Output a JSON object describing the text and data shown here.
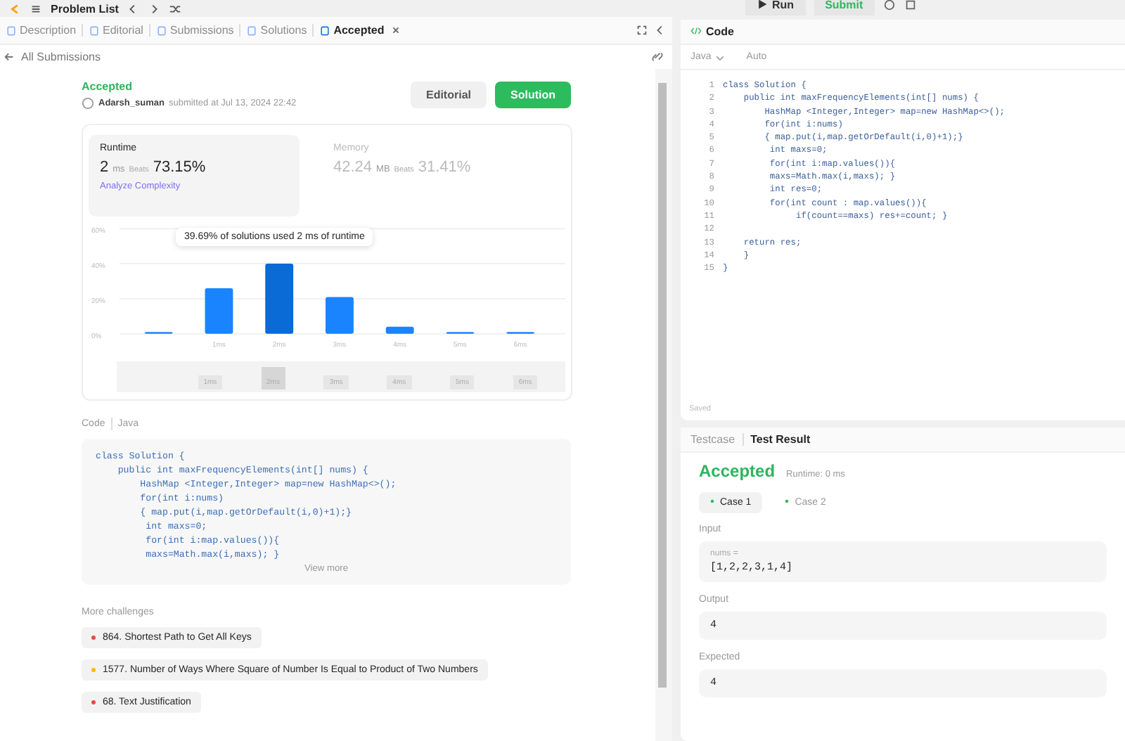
{
  "top_bar": {
    "title": "Problem List",
    "run": "Run",
    "submit": "Submit"
  },
  "left_tabs": [
    {
      "label": "Description",
      "selected": false
    },
    {
      "label": "Editorial",
      "selected": false
    },
    {
      "label": "Submissions",
      "selected": false
    },
    {
      "label": "Solutions",
      "selected": false
    },
    {
      "label": "Accepted",
      "selected": true,
      "closable": true
    }
  ],
  "back_link": "All Submissions",
  "submission": {
    "status": "Accepted",
    "user": "Adarsh_suman",
    "submitted": "submitted at Jul 13, 2024 22:42",
    "editorial_button": "Editorial",
    "solution_button": "Solution"
  },
  "runtime": {
    "title": "Runtime",
    "value": "2",
    "unit": "ms",
    "beats_label": "Beats",
    "beats": "73.15%",
    "analyze": "Analyze Complexity",
    "selected": true
  },
  "memory": {
    "title": "Memory",
    "value": "42.24",
    "unit": "MB",
    "beats_label": "Beats",
    "beats": "31.41%",
    "selected": false
  },
  "chart": {
    "tooltip": "39.69% of solutions used 2 ms of runtime",
    "bars": [
      {
        "selected": false
      },
      {
        "selected": false
      },
      {
        "selected": true
      },
      {
        "selected": false
      },
      {
        "selected": false
      },
      {
        "selected": false
      },
      {
        "selected": false
      }
    ],
    "chart_data": {
      "type": "bar",
      "categories": [
        null,
        "1ms",
        "2ms",
        "3ms",
        "4ms",
        "5ms",
        "6ms"
      ],
      "values": [
        1,
        26,
        40,
        21,
        4,
        1,
        1
      ],
      "ylim": [
        0,
        60
      ],
      "yticks": [
        {
          "value": 0,
          "label": "0%"
        },
        {
          "value": 20,
          "label": "20%"
        },
        {
          "value": 40,
          "label": "40%"
        },
        {
          "value": 60,
          "label": "60%"
        }
      ]
    },
    "range_labels": [
      {
        "label": "1ms",
        "selected": false
      },
      {
        "label": "2ms",
        "selected": true
      },
      {
        "label": "3ms",
        "selected": false
      },
      {
        "label": "4ms",
        "selected": false
      },
      {
        "label": "5ms",
        "selected": false
      },
      {
        "label": "6ms",
        "selected": false
      }
    ]
  },
  "code_section": {
    "label": "Code",
    "language": "Java",
    "view_more": "View more",
    "lines": [
      "class Solution {",
      "    public int maxFrequencyElements(int[] nums) {",
      "        HashMap <Integer,Integer> map=new HashMap<>();",
      "        for(int i:nums)",
      "        { map.put(i,map.getOrDefault(i,0)+1);}",
      "         int maxs=0;",
      "         for(int i:map.values()){",
      "         maxs=Math.max(i,maxs); }"
    ]
  },
  "more_challenges": {
    "title": "More challenges",
    "items": [
      {
        "label": "864. Shortest Path to Get All Keys",
        "color": "#ef4743"
      },
      {
        "label": "1577. Number of Ways Where Square of Number Is Equal to Product of Two Numbers",
        "color": "#ffb800"
      },
      {
        "label": "68. Text Justification",
        "color": "#ef4743"
      }
    ]
  },
  "editor": {
    "title": "Code",
    "language": "Java",
    "mode": "Auto",
    "saved": "Saved",
    "lines": [
      {
        "no": "1",
        "text": "class Solution {"
      },
      {
        "no": "2",
        "text": "    public int maxFrequencyElements(int[] nums) {"
      },
      {
        "no": "3",
        "text": "        HashMap <Integer,Integer> map=new HashMap<>();"
      },
      {
        "no": "4",
        "text": "        for(int i:nums)"
      },
      {
        "no": "5",
        "text": "        { map.put(i,map.getOrDefault(i,0)+1);}"
      },
      {
        "no": "6",
        "text": "         int maxs=0;"
      },
      {
        "no": "7",
        "text": "         for(int i:map.values()){"
      },
      {
        "no": "8",
        "text": "         maxs=Math.max(i,maxs); }"
      },
      {
        "no": "9",
        "text": "         int res=0;"
      },
      {
        "no": "10",
        "text": "         for(int count : map.values()){"
      },
      {
        "no": "11",
        "text": "              if(count==maxs) res+=count; }"
      },
      {
        "no": "12"
      },
      {
        "no": "13",
        "text": "    return res;"
      },
      {
        "no": "14",
        "text": "    }"
      },
      {
        "no": "15",
        "text": "}"
      }
    ]
  },
  "result_tabs": [
    {
      "label": "Testcase",
      "selected": false
    },
    {
      "label": "Test Result",
      "selected": true
    }
  ],
  "result": {
    "status": "Accepted",
    "runtime": "Runtime: 0 ms",
    "cases": [
      {
        "label": "Case 1",
        "selected": true
      },
      {
        "label": "Case 2",
        "selected": false
      }
    ],
    "input_label": "Input",
    "input_name": "nums =",
    "input_value": "[1,2,2,3,1,4]",
    "output_label": "Output",
    "output_value": "4",
    "expected_label": "Expected",
    "expected_value": "4"
  }
}
